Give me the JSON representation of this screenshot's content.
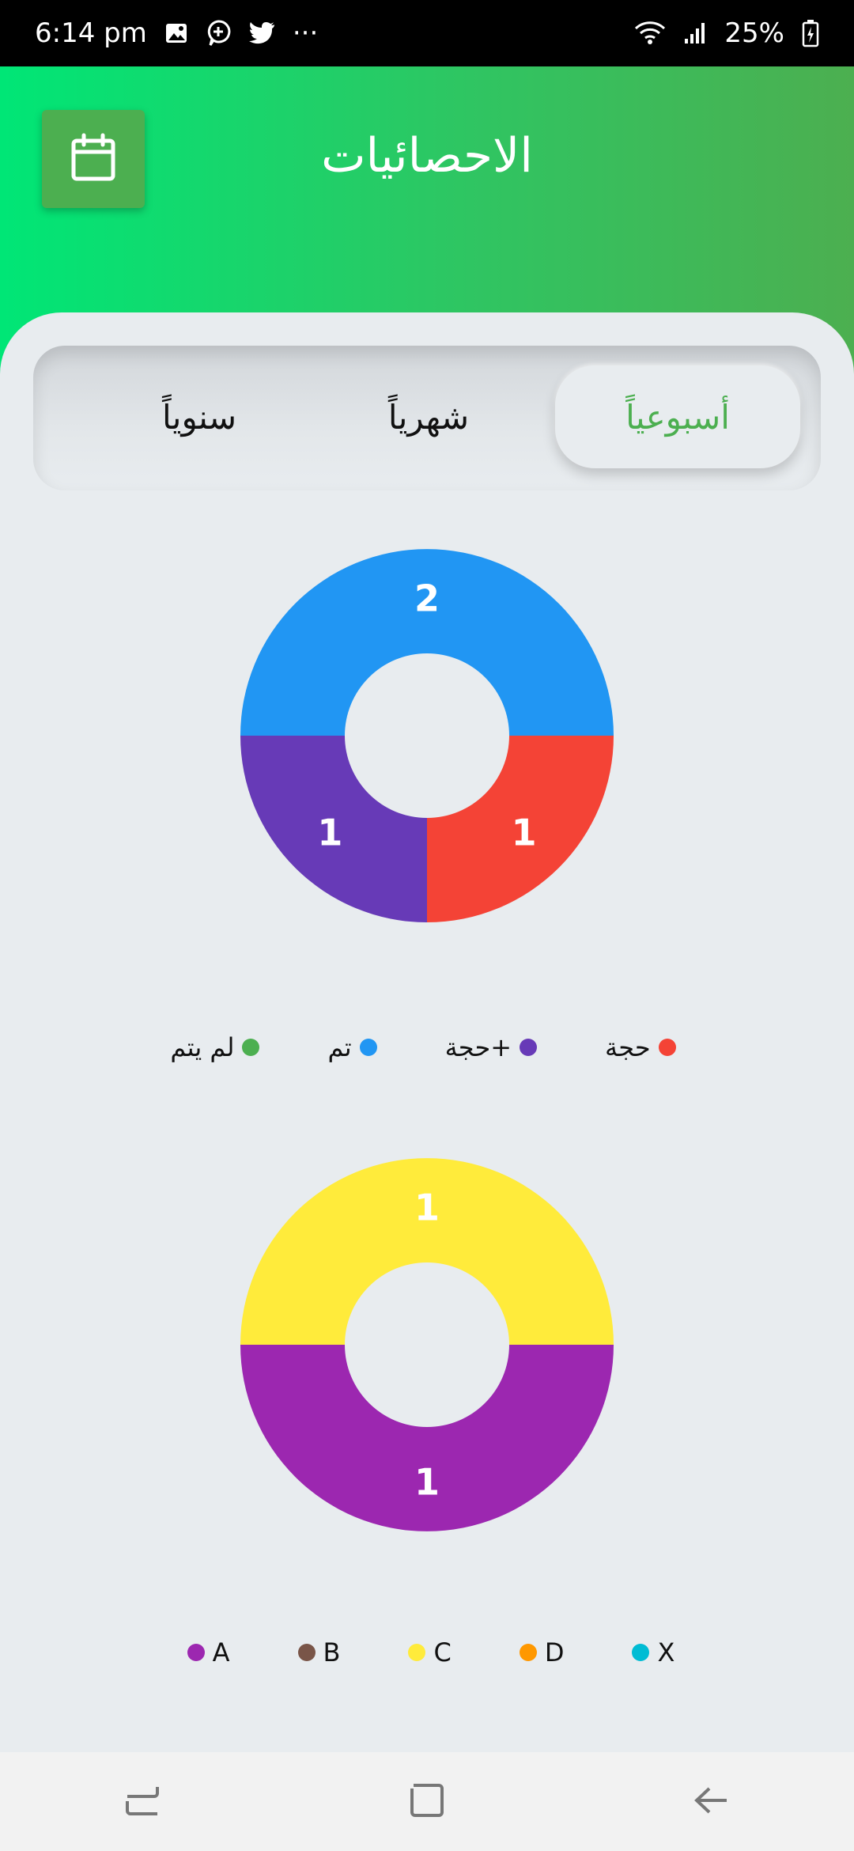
{
  "status_bar": {
    "time": "6:14 pm",
    "more": "···",
    "battery": "25%"
  },
  "header": {
    "title": "الاحصائيات"
  },
  "tabs": [
    {
      "label": "أسبوعياً",
      "active": true
    },
    {
      "label": "شهرياً",
      "active": false
    },
    {
      "label": "سنوياً",
      "active": false
    }
  ],
  "chart_data": [
    {
      "type": "pie",
      "donut": true,
      "slices": [
        {
          "label": "تم",
          "value": 2,
          "color": "#2196f3"
        },
        {
          "label": "حجة",
          "value": 1,
          "color": "#f44336"
        },
        {
          "label": "+حجة",
          "value": 1,
          "color": "#673ab7"
        },
        {
          "label": "لم يتم",
          "value": 0,
          "color": "#4caf50"
        }
      ],
      "legend": [
        {
          "label": "حجة",
          "color": "#f44336"
        },
        {
          "label": "+حجة",
          "color": "#673ab7"
        },
        {
          "label": "تم",
          "color": "#2196f3"
        },
        {
          "label": "لم يتم",
          "color": "#4caf50"
        }
      ]
    },
    {
      "type": "pie",
      "donut": true,
      "slices": [
        {
          "label": "C",
          "value": 1,
          "color": "#ffeb3b"
        },
        {
          "label": "A",
          "value": 1,
          "color": "#9c27b0"
        },
        {
          "label": "B",
          "value": 0,
          "color": "#795548"
        },
        {
          "label": "D",
          "value": 0,
          "color": "#ff9800"
        },
        {
          "label": "X",
          "value": 0,
          "color": "#00bcd4"
        }
      ],
      "legend": [
        {
          "label": "A",
          "color": "#9c27b0"
        },
        {
          "label": "B",
          "color": "#795548"
        },
        {
          "label": "C",
          "color": "#ffeb3b"
        },
        {
          "label": "D",
          "color": "#ff9800"
        },
        {
          "label": "X",
          "color": "#00bcd4"
        }
      ]
    }
  ],
  "icons": {
    "calendar": "calendar-icon",
    "nav_recent": "recent-apps-icon",
    "nav_home": "home-icon",
    "nav_back": "back-icon"
  }
}
